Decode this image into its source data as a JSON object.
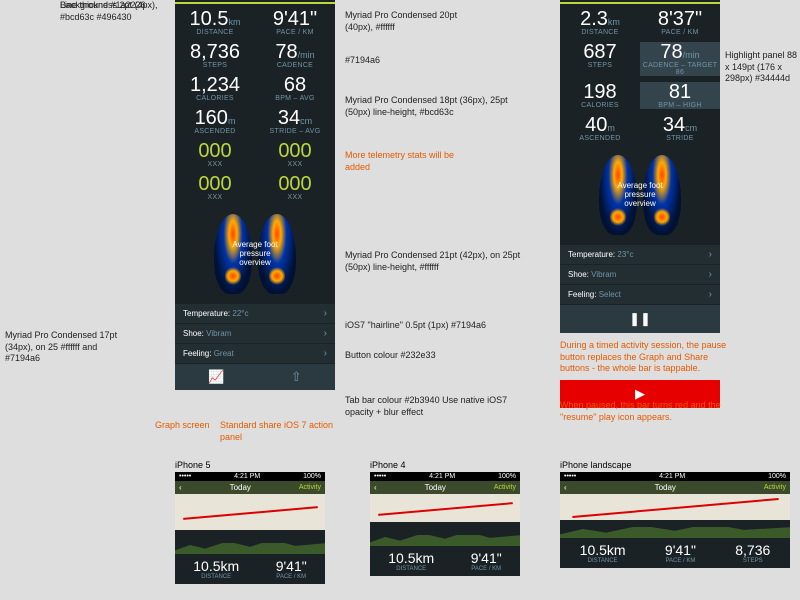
{
  "phone1": {
    "distance": {
      "val": "10.5",
      "unit": "km",
      "label": "DISTANCE"
    },
    "pace": {
      "val": "9'41\"",
      "label": "PACE / km"
    },
    "steps": {
      "val": "8,736",
      "label": "STEPS"
    },
    "cadence": {
      "val": "78",
      "unit": "/min",
      "label": "CADENCE"
    },
    "calories": {
      "val": "1,234",
      "label": "CALORIES"
    },
    "bpm": {
      "val": "68",
      "label": "BPM – avg"
    },
    "ascended": {
      "val": "160",
      "unit": "m",
      "label": "ASCENDED"
    },
    "stride": {
      "val": "34",
      "unit": "cm",
      "label": "STRIDE – avg"
    },
    "z1": {
      "val": "000",
      "label": "XXX"
    },
    "z2": {
      "val": "000",
      "label": "XXX"
    },
    "z3": {
      "val": "000",
      "label": "XXX"
    },
    "z4": {
      "val": "000",
      "label": "XXX"
    },
    "feet": "Average\nfoot pressure\noverview",
    "temp": {
      "label": "Temperature:",
      "val": "22°c"
    },
    "shoe": {
      "label": "Shoe:",
      "val": "Vibram"
    },
    "feeling": {
      "label": "Feeling:",
      "val": "Great"
    }
  },
  "phone2": {
    "distance": {
      "val": "2.3",
      "unit": "km",
      "label": "DISTANCE"
    },
    "pace": {
      "val": "8'37\"",
      "label": "PACE / km"
    },
    "steps": {
      "val": "687",
      "label": "STEPS"
    },
    "cadence": {
      "val": "78",
      "unit": "/min",
      "label": "CADENCE – target 86"
    },
    "calories": {
      "val": "198",
      "label": "CALORIES"
    },
    "bpm": {
      "val": "81",
      "label": "BPM – HIGH"
    },
    "ascended": {
      "val": "40",
      "unit": "m",
      "label": "ASCENDED"
    },
    "stride": {
      "val": "34",
      "unit": "cm",
      "label": "STRIDE"
    },
    "feet": "Average\nfoot pressure\noverview",
    "temp": {
      "label": "Temperature:",
      "val": "23°c"
    },
    "shoe": {
      "label": "Shoe:",
      "val": "Vibram"
    },
    "feeling": {
      "label": "Feeling:",
      "val": "Select"
    }
  },
  "annotations": {
    "a1": "Line thickness 2pt (4px), #bcd63c\n#496430",
    "a2": "Background #1a2226",
    "a3": "Myriad Pro Condensed\n17pt (34px), on 25 #ffffff and #7194a6",
    "a4": "Graph screen",
    "a5": "Standard share iOS 7\naction panel",
    "a6": "Myriad Pro Condensed\n20pt (40px), #ffffff",
    "a7": "#7194a6",
    "a8": "Myriad Pro Condensed\n18pt (36px), 25pt (50px) line-height, #bcd63c",
    "a9": "More telemetry\nstats will be added",
    "a10": "Myriad Pro Condensed\n21pt (42px), on 25pt (50px) line-height, #ffffff",
    "a11": "iOS7 \"hairline\" 0.5pt (1px) #7194a6",
    "a12": "Button colour #232e33",
    "a13": "Tab bar colour #2b3940\nUse native iOS7 opacity + blur effect",
    "a14": "Highlight panel 88 x 149pt\n(176 x 298px)\n#34444d",
    "a15": "During a timed activity session, the\npause button replaces the Graph and Share\nbuttons - the whole bar is tappable.",
    "a16": "When paused, this bar turns red and\nthe \"resume\" play icon appears."
  },
  "mini": {
    "t1": "iPhone 5",
    "t2": "iPhone 4",
    "t3": "iPhone landscape",
    "time": "4:21 PM",
    "today": "Today",
    "activity": "Activity",
    "d": {
      "val": "10.5km",
      "lbl": "DISTANCE"
    },
    "p": {
      "val": "9'41\"",
      "lbl": "PACE / km"
    },
    "s": {
      "val": "8,736",
      "lbl": "STEPS"
    }
  }
}
